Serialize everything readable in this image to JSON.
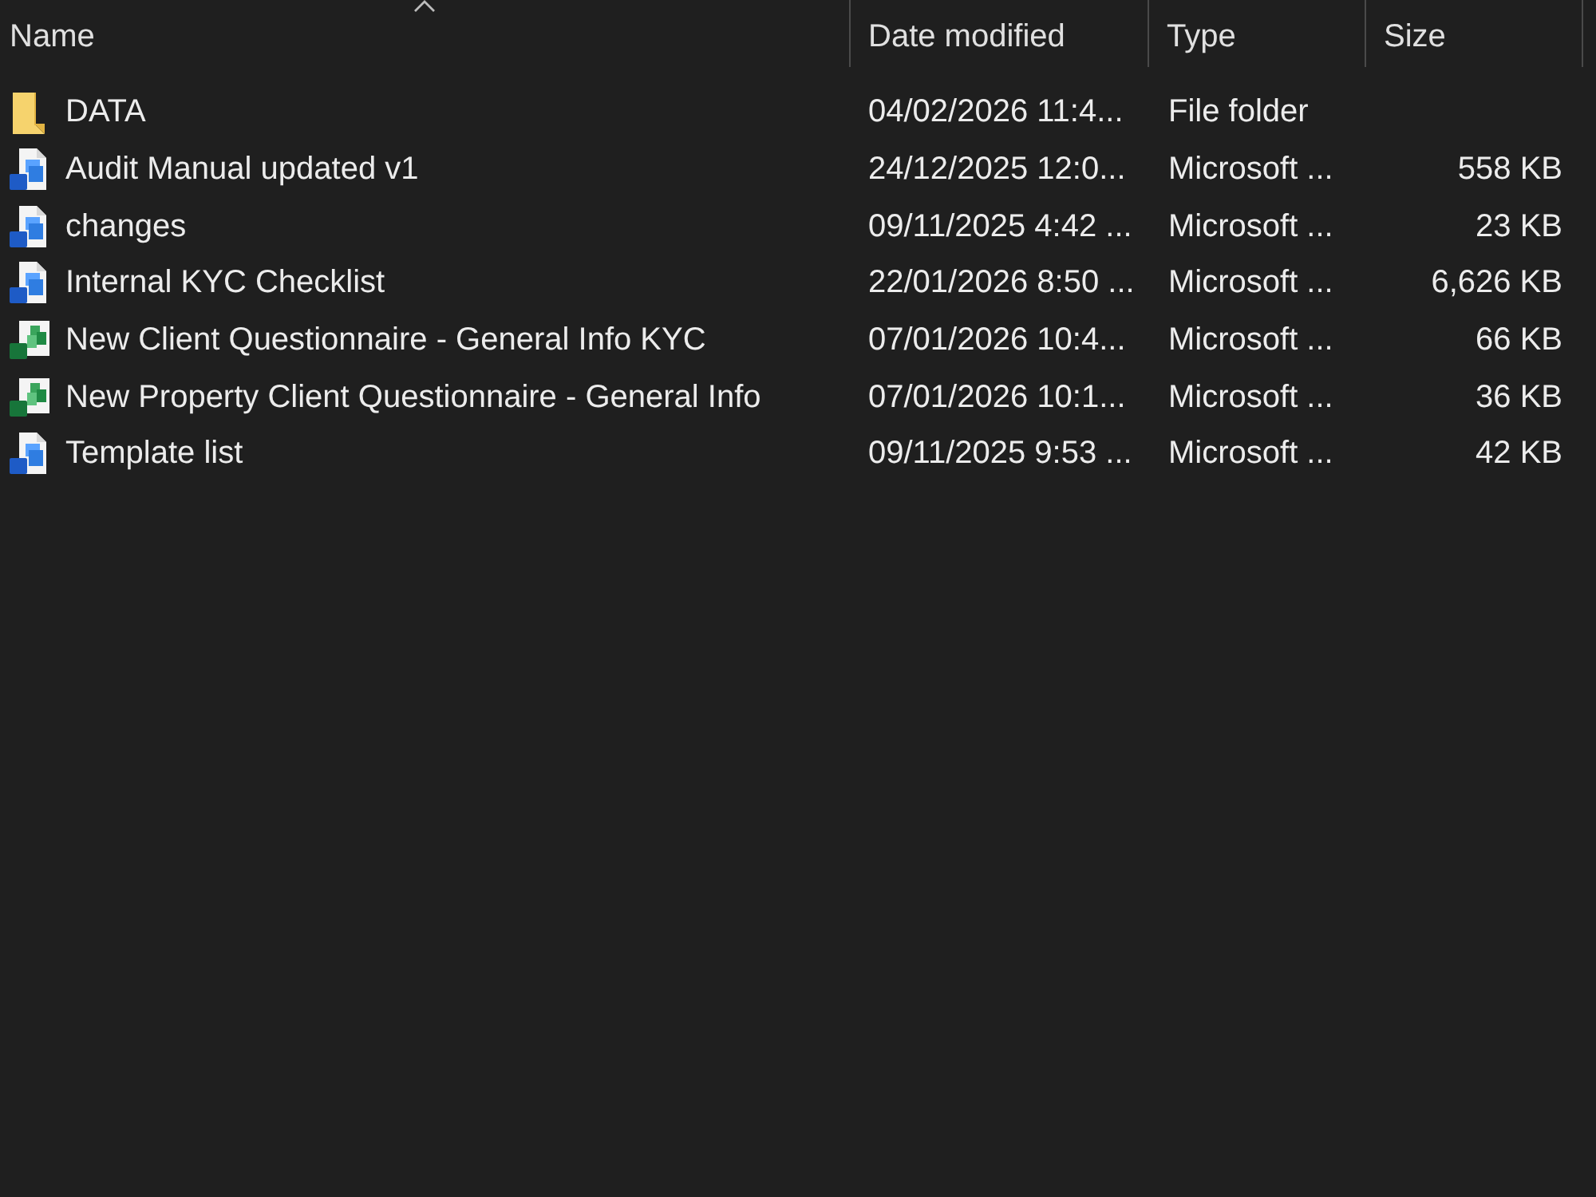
{
  "columns": [
    {
      "label": "Name",
      "sorted": true
    },
    {
      "label": "Date modified",
      "sorted": false
    },
    {
      "label": "Type",
      "sorted": false
    },
    {
      "label": "Size",
      "sorted": false
    }
  ],
  "files": [
    {
      "kind": "folder",
      "name": "DATA",
      "date_modified": "04/02/2026 11:4...",
      "type": "File folder"
    },
    {
      "kind": "document",
      "name": "Audit Manual updated v1",
      "date_modified": "24/12/2025 12:0...",
      "type": "Microsoft ...",
      "size": "558 KB"
    },
    {
      "kind": "document",
      "name": "changes",
      "date_modified": "09/11/2025 4:42 ...",
      "type": "Microsoft ...",
      "size": "23 KB"
    },
    {
      "kind": "document",
      "name": "Internal KYC Checklist",
      "date_modified": "22/01/2026 8:50 ...",
      "type": "Microsoft ...",
      "size": "6,626 KB"
    },
    {
      "kind": "spreadsheet",
      "name": "New Client Questionnaire - General Info KYC",
      "date_modified": "07/01/2026 10:4...",
      "type": "Microsoft ...",
      "size": "66 KB"
    },
    {
      "kind": "spreadsheet",
      "name": "New Property Client Questionnaire - General Info",
      "date_modified": "07/01/2026 10:1...",
      "type": "Microsoft ...",
      "size": "36 KB"
    },
    {
      "kind": "document",
      "name": "Template list",
      "date_modified": "09/11/2025 9:53 ...",
      "type": "Microsoft ...",
      "size": "42 KB"
    }
  ]
}
